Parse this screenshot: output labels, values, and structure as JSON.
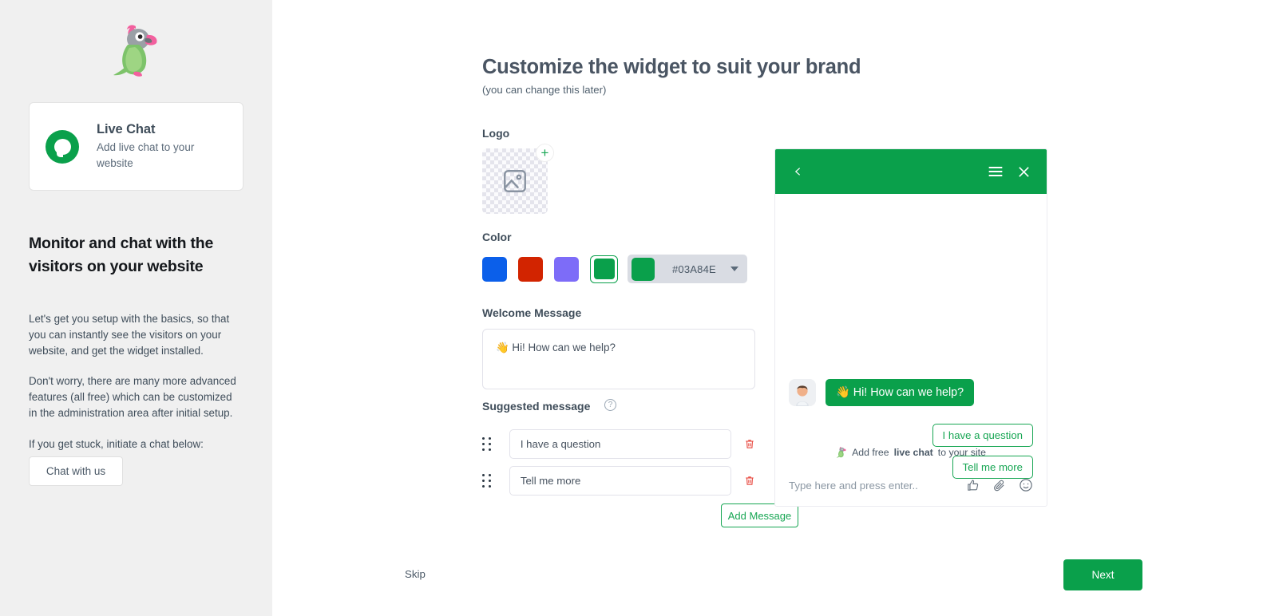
{
  "sidebar": {
    "logo_icon": "parrot-logo",
    "product_card": {
      "icon": "live-chat-bubble-icon",
      "title": "Live Chat",
      "subtitle": "Add live chat to your website"
    },
    "heading": "Monitor and chat with the visitors on your website",
    "paragraphs": [
      "Let's get you setup with the basics, so that you can instantly see the visitors on your website, and get the widget installed.",
      "Don't worry, there are many more advanced features (all free) which can be customized in the administration area after initial setup.",
      "If you get stuck, initiate a chat below:"
    ],
    "chat_button": "Chat with us"
  },
  "main": {
    "title": "Customize the widget to suit your brand",
    "subtitle": "(you can change this later)",
    "logo": {
      "label": "Logo",
      "placeholder_icon": "image-placeholder-icon",
      "add_icon": "plus-icon"
    },
    "color": {
      "label": "Color",
      "swatches": [
        "#0b5fea",
        "#d22400",
        "#7d6cf8",
        "#0aa04b"
      ],
      "selected": "#0aa04b",
      "hex_value": "#03A84E",
      "caret_icon": "chevron-down-icon"
    },
    "welcome": {
      "label": "Welcome Message",
      "value": "👋 Hi! How can we help?"
    },
    "suggested": {
      "label": "Suggested message",
      "help_icon": "question-mark-icon",
      "items": [
        {
          "value": "I have a question",
          "drag_icon": "drag-handle-icon",
          "delete_icon": "trash-icon"
        },
        {
          "value": "Tell me more",
          "drag_icon": "drag-handle-icon",
          "delete_icon": "trash-icon"
        }
      ],
      "add_button": "Add Message"
    }
  },
  "widget": {
    "header": {
      "back_icon": "chevron-left-icon",
      "menu_icon": "hamburger-menu-icon",
      "close_icon": "close-x-icon"
    },
    "avatar_icon": "agent-avatar-icon",
    "message": "👋 Hi! How can we help?",
    "suggestions": [
      "I have a question",
      "Tell me more"
    ],
    "promo": {
      "icon": "parrot-icon",
      "prefix": "Add free ",
      "bold": "live chat",
      "suffix": " to your site"
    },
    "input_placeholder": "Type here and press enter..",
    "input_icons": [
      "thumbs-up-icon",
      "paperclip-icon",
      "emoji-smiley-icon"
    ],
    "launcher_icon": "chat-launcher-icon"
  },
  "footer": {
    "skip": "Skip",
    "next": "Next"
  }
}
